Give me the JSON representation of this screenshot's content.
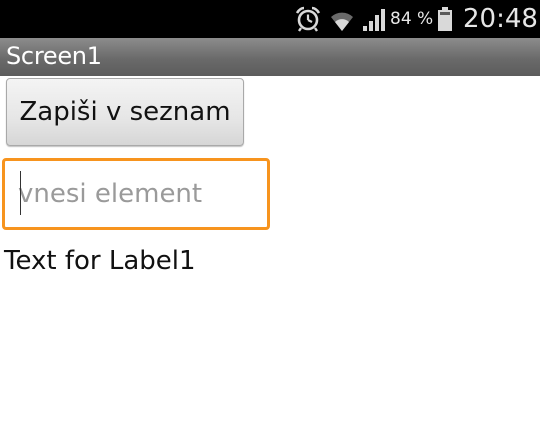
{
  "status_bar": {
    "icons": [
      "alarm-icon",
      "wifi-icon",
      "signal-icon",
      "battery-icon"
    ],
    "battery_percent": "84 %",
    "time": "20:48"
  },
  "app": {
    "title": "Screen1",
    "button_label": "Zapiši v seznam",
    "input_placeholder": "vnesi element",
    "input_value": "",
    "label_text": "Text for Label1"
  },
  "colors": {
    "accent_focus": "#f7941e",
    "status_bar_bg": "#000000",
    "title_bar_bg": "#6a6a6a"
  }
}
